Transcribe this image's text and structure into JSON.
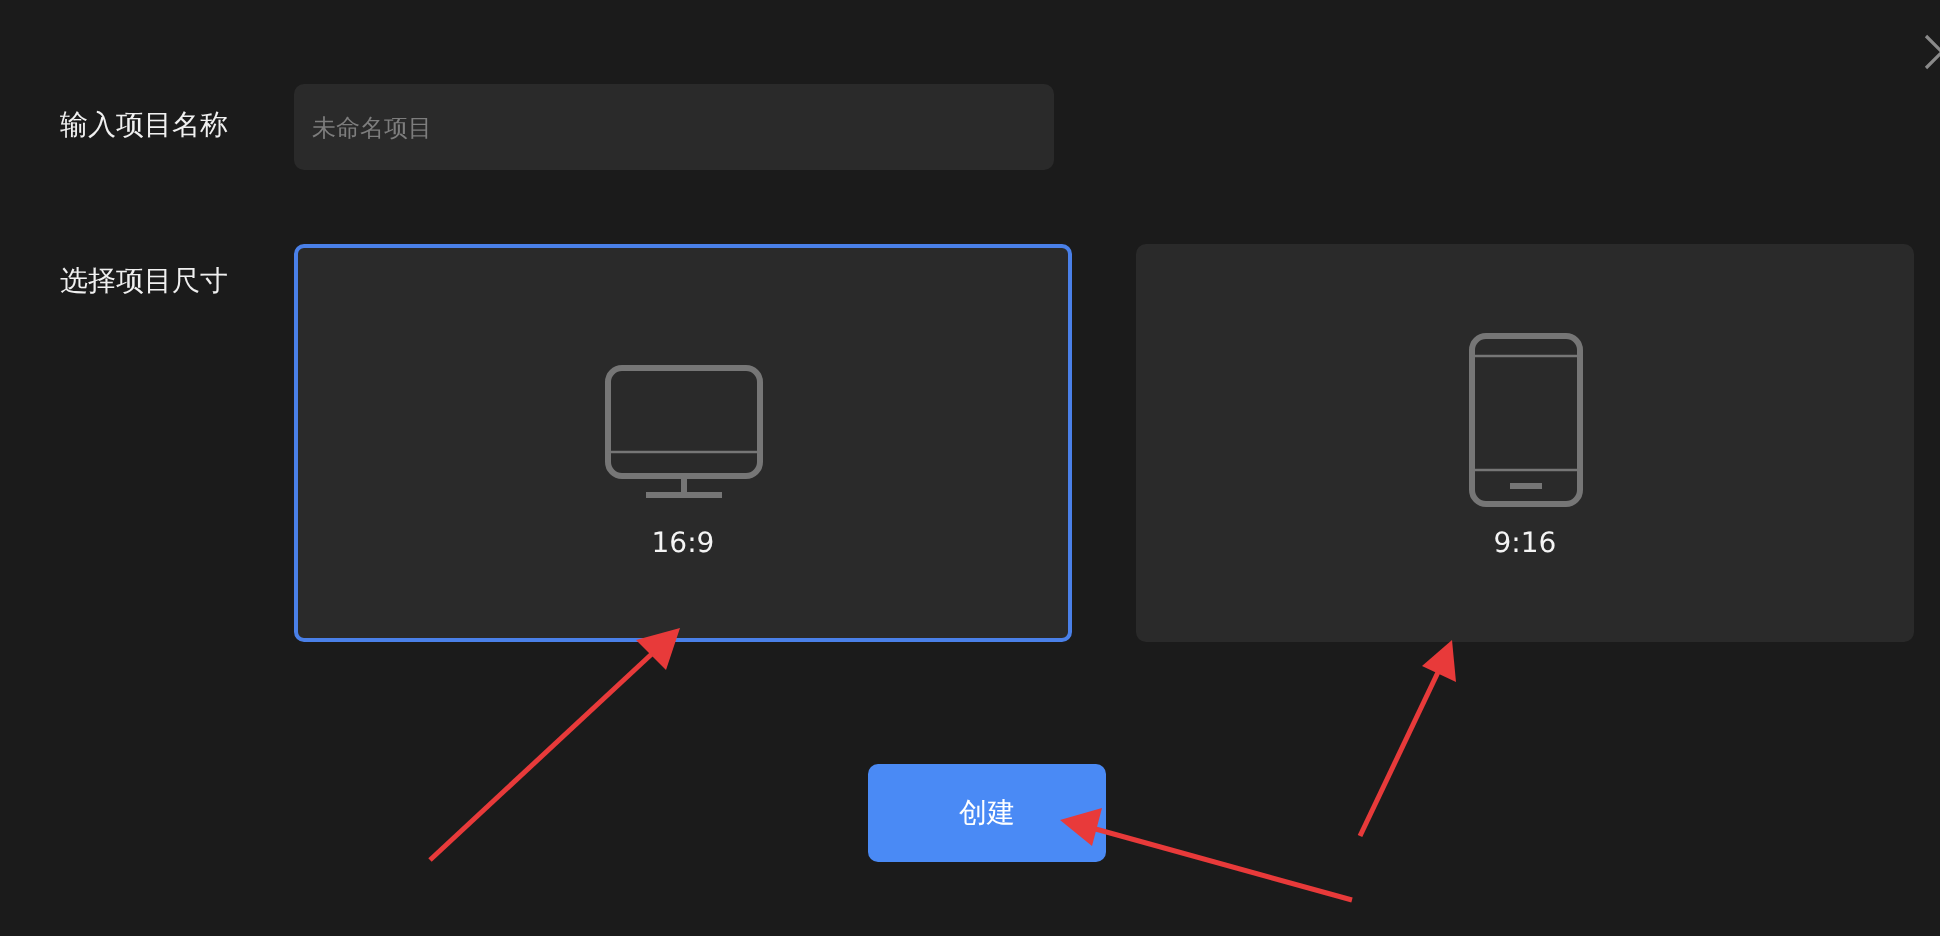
{
  "name_field": {
    "label": "输入项目名称",
    "placeholder": "未命名项目"
  },
  "size_picker": {
    "label": "选择项目尺寸",
    "options": [
      {
        "kind": "monitor",
        "label": "16:9",
        "selected": true
      },
      {
        "kind": "phone",
        "label": "9:16",
        "selected": false
      }
    ]
  },
  "create_button": "创建"
}
